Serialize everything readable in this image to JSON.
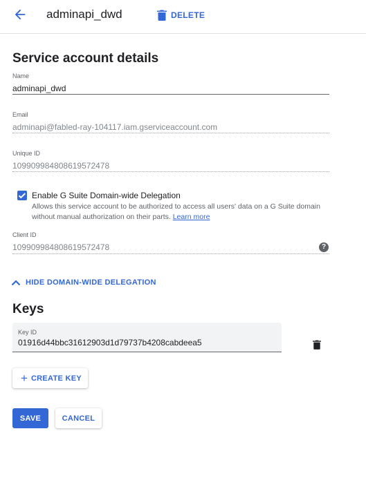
{
  "header": {
    "back_icon": "arrow-back-icon",
    "title": "adminapi_dwd",
    "delete_icon": "trash-icon",
    "delete_label": "DELETE"
  },
  "details": {
    "section_title": "Service account details",
    "name": {
      "label": "Name",
      "value": "adminapi_dwd"
    },
    "email": {
      "label": "Email",
      "value": "adminapi@fabled-ray-104117.iam.gserviceaccount.com"
    },
    "unique_id": {
      "label": "Unique ID",
      "value": "109909984808619572478"
    },
    "delegation": {
      "checked": true,
      "label": "Enable G Suite Domain-wide Delegation",
      "description": "Allows this service account to be authorized to access all users' data on a G Suite domain without manual authorization on their parts.",
      "learn_more": "Learn more"
    },
    "client_id": {
      "label": "Client ID",
      "value": "109909984808619572478",
      "help_icon": "help-icon"
    },
    "hide_delegation_label": "HIDE DOMAIN-WIDE DELEGATION"
  },
  "keys": {
    "section_title": "Keys",
    "items": [
      {
        "label": "Key ID",
        "value": "01916d44bbc31612903d1d79737b4208cabdeea5"
      }
    ],
    "create_key_label": "CREATE KEY"
  },
  "actions": {
    "save_label": "SAVE",
    "cancel_label": "CANCEL"
  },
  "colors": {
    "accent": "#3367d6",
    "text": "#202124",
    "secondary_text": "#5f6368"
  }
}
